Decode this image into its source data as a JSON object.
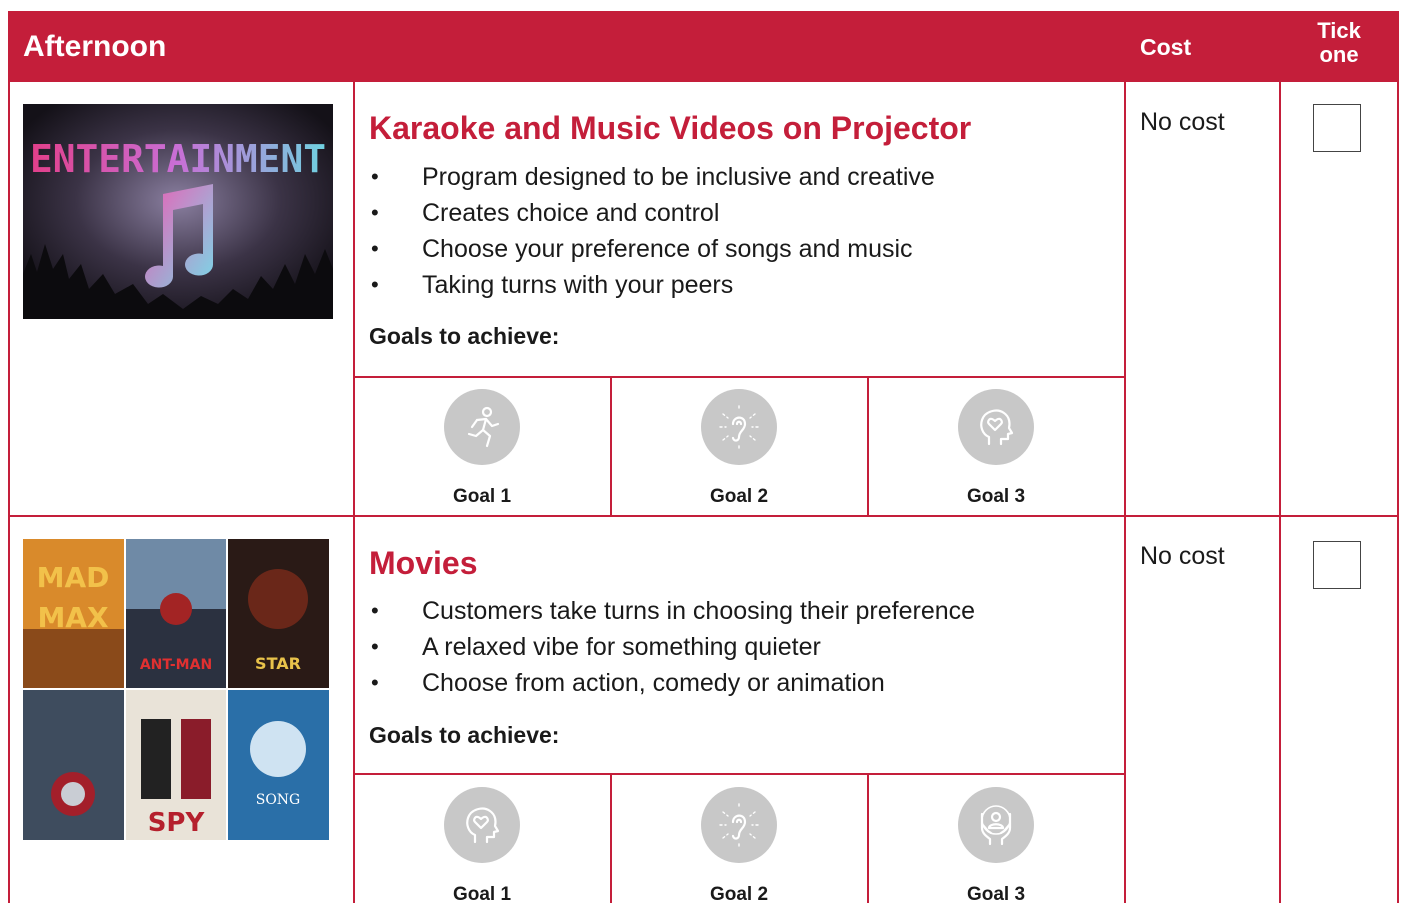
{
  "colors": {
    "accent": "#c41e3a",
    "goal_circle": "#c8c8c8"
  },
  "header": {
    "title": "Afternoon",
    "cost": "Cost",
    "tick_line1": "Tick",
    "tick_line2": "one"
  },
  "activities": [
    {
      "title": "Karaoke and Music Videos on Projector",
      "image_text": "ENTERTAINMENT",
      "bullets": [
        "Program designed to be inclusive and creative",
        "Creates choice and control",
        "Choose your preference of songs and music",
        "Taking turns with your peers"
      ],
      "goals_label": "Goals to achieve:",
      "goals": [
        {
          "label": "Goal 1",
          "icon": "running-person-icon"
        },
        {
          "label": "Goal 2",
          "icon": "ear-icon"
        },
        {
          "label": "Goal 3",
          "icon": "head-heart-icon"
        }
      ],
      "cost": "No cost",
      "checked": false
    },
    {
      "title": "Movies",
      "bullets": [
        "Customers take turns in choosing their preference",
        "A relaxed vibe for something quieter",
        "Choose from action, comedy or animation"
      ],
      "goals_label": "Goals to achieve:",
      "goals": [
        {
          "label": "Goal 1",
          "icon": "head-heart-icon"
        },
        {
          "label": "Goal 2",
          "icon": "ear-icon"
        },
        {
          "label": "Goal 3",
          "icon": "hands-person-icon"
        }
      ],
      "cost": "No cost",
      "checked": false
    }
  ]
}
